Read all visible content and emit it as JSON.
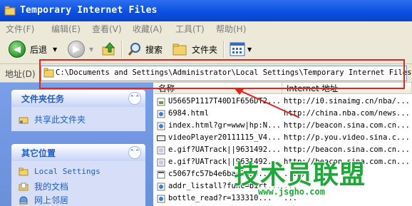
{
  "window": {
    "title": "Temporary Internet Files"
  },
  "menu": [
    "文件(F)",
    "编辑(E)",
    "查看(V)",
    "收藏(A)",
    "工具(T)",
    "帮助(H)"
  ],
  "toolbar": {
    "back_label": "后退",
    "search_label": "搜索",
    "folders_label": "文件夹"
  },
  "address": {
    "label": "地址(D)",
    "path": "C:\\Documents and Settings\\Administrator\\Local Settings\\Temporary Internet Files"
  },
  "sidebar": {
    "tasks": {
      "title": "文件夹任务",
      "items": [
        "共享此文件夹"
      ]
    },
    "places": {
      "title": "其它位置",
      "items": [
        "Local Settings",
        "我的文档",
        "网上邻居"
      ]
    }
  },
  "files": {
    "columns": [
      "名称",
      "Internet 地址"
    ],
    "rows": [
      {
        "name": "U5665P1117T40D1F656DT2...",
        "url": "http://i0.sinaimg.cn/nba/..."
      },
      {
        "name": "6984.html",
        "url": "http://china.nba.com/news..."
      },
      {
        "name": "index.html?gr=www|hp:N...",
        "url": "http://beacon.sina.com.cn..."
      },
      {
        "name": "videoPlayer20111115_V4...",
        "url": "http://p.you.video.sina.c..."
      },
      {
        "name": "e.gif?UATrack||9631492...",
        "url": "http://beacon.sina.com.cn..."
      },
      {
        "name": "e.gif?UATrack||9631492...",
        "url": "http://beacon.sina.com.cn..."
      },
      {
        "name": "c5067fc57b4e6bac2636...",
        "url": "...n/"
      },
      {
        "name": "addr_listall?func=birt...",
        "url": "..."
      },
      {
        "name": "bottle_read?r=133310...",
        "url": "..."
      }
    ]
  },
  "watermark": {
    "text": "技术员联盟",
    "url": "www.jsgho.com"
  }
}
